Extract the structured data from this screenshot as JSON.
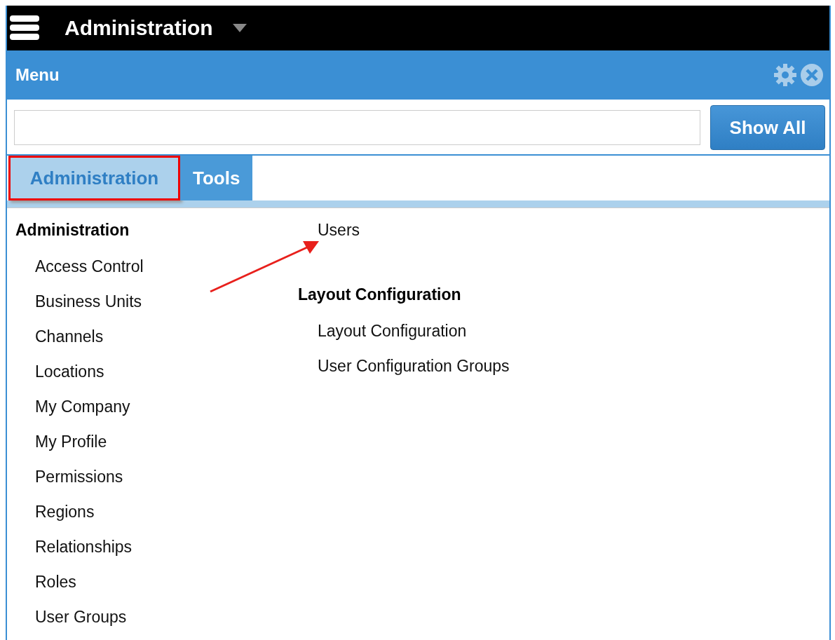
{
  "top_bar": {
    "title": "Administration"
  },
  "menu_panel": {
    "title": "Menu"
  },
  "search": {
    "button": "Show All"
  },
  "tabs": [
    {
      "label": "Administration",
      "selected": true,
      "annotated": true
    },
    {
      "label": "Tools",
      "selected": false,
      "annotated": false
    }
  ],
  "columns": [
    {
      "groups": [
        {
          "heading": "Administration",
          "items": [
            "Access Control",
            "Business Units",
            "Channels",
            "Locations",
            "My Company",
            "My Profile",
            "Permissions",
            "Regions",
            "Relationships",
            "Roles",
            "User Groups"
          ]
        }
      ]
    },
    {
      "groups": [
        {
          "items": [
            "Users"
          ]
        },
        {
          "heading": "Layout Configuration",
          "items": [
            "Layout Configuration",
            "User Configuration Groups"
          ]
        }
      ]
    }
  ]
}
